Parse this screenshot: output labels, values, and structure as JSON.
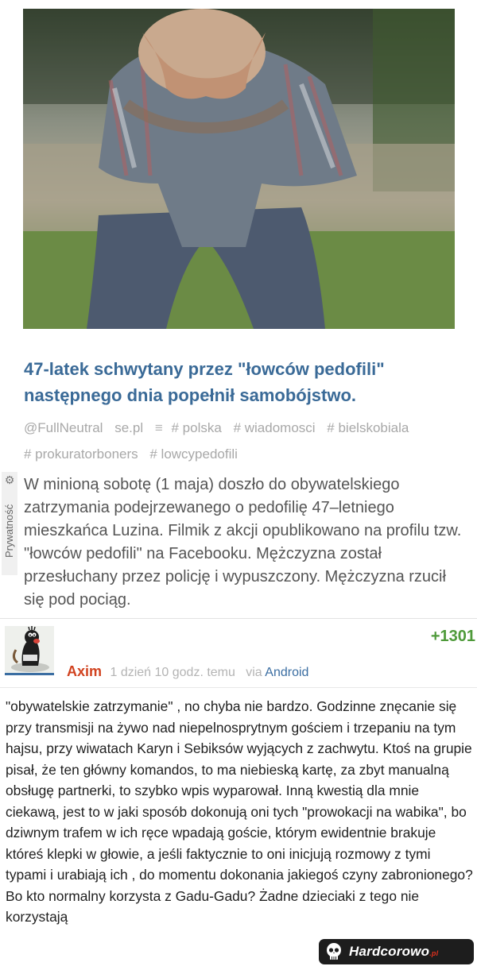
{
  "article": {
    "headline": "47-latek schwytany przez \"łowców pedofili\" następnego dnia popełnił samobójstwo.",
    "source": "@FullNeutral",
    "source_domain": "se.pl",
    "menu_icon": "list-icon",
    "tags": [
      "# polska",
      "# wiadomosci",
      "# bielskobiala",
      "# prokuratorboners",
      "# lowcypedofili"
    ],
    "lead": "W minioną sobotę (1 maja) doszło do obywatelskiego zatrzymania podejrzewanego o pedofilię 47–letniego mieszkańca Luzina. Filmik z akcji opublikowano na profilu tzw. \"łowców pedofili\" na Facebooku. Mężczyzna został przesłuchany przez policję i wypuszczony. Mężczyzna rzucił się pod pociąg."
  },
  "privacy": {
    "label": "Prywatność",
    "icon": "gear-icon"
  },
  "comment": {
    "score": "+1301",
    "author": "Axim",
    "time": "1 dzień 10 godz. temu",
    "via_label": "via",
    "via_app": "Android",
    "text": "\"obywatelskie zatrzymanie\" , no chyba nie bardzo. Godzinne znęcanie się przy transmisji na żywo nad niepelnosprytnym gościem i trzepaniu na tym hajsu, przy wiwatach Karyn i Sebiksów wyjących z zachwytu. Ktoś na grupie pisał, że ten główny komandos, to ma niebieską kartę, za zbyt manualną obsługę partnerki, to szybko wpis wyparował. Inną kwestią dla mnie ciekawą, jest to w jaki sposób dokonują oni tych \"prowokacji na wabika\", bo dziwnym trafem w ich ręce wpadają goście, którym ewidentnie brakuje któreś klepki w głowie, a jeśli faktycznie to oni inicjują rozmowy z tymi typami i urabiają ich , do momentu dokonania jakiegoś czyny zabronionego? Bo kto normalny korzysta z Gadu-Gadu? Żadne dzieciaki z tego nie korzystają"
  },
  "watermark": {
    "text": "Hardcorowo",
    "suffix": ".pl",
    "icon": "skull-icon"
  },
  "colors": {
    "headline": "#3a6a97",
    "author": "#d1421f",
    "score": "#4e9a3a",
    "link": "#3b6ea2"
  }
}
